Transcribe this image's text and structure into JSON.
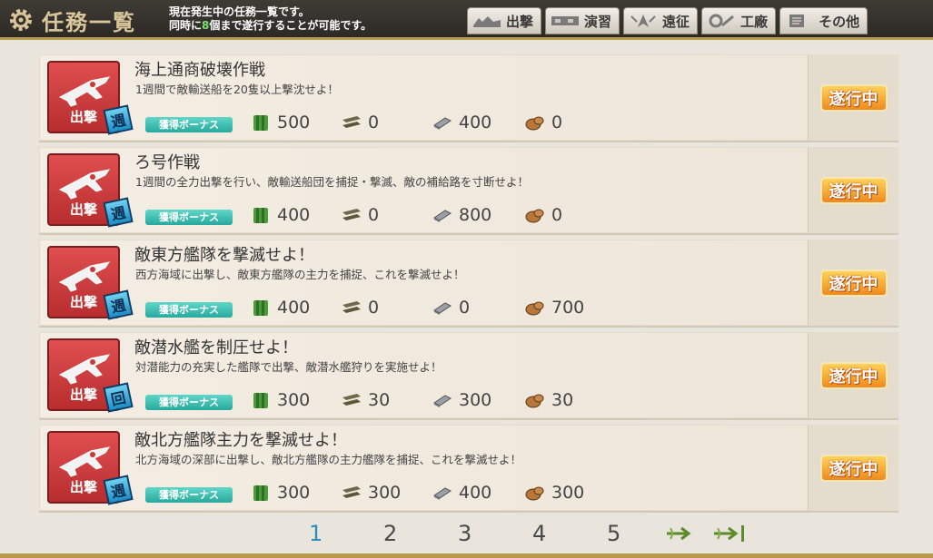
{
  "header": {
    "title": "任務一覧",
    "subtitle_line1": "現在発生中の任務一覧です。",
    "subtitle_line2_pre": "同時に",
    "subtitle_line2_num": "8",
    "subtitle_line2_post": "個まで遂行することが可能です。",
    "tabs": [
      {
        "label": "出撃",
        "icon": "sortie-icon"
      },
      {
        "label": "演習",
        "icon": "exercise-icon"
      },
      {
        "label": "遠征",
        "icon": "expedition-icon"
      },
      {
        "label": "工廠",
        "icon": "arsenal-icon"
      },
      {
        "label": "その他",
        "icon": "other-icon"
      }
    ]
  },
  "quests": [
    {
      "name": "海上通商破壊作戦",
      "desc": "1週間で敵輸送船を20隻以上撃沈せよ！",
      "category": "出撃",
      "freq": "週",
      "bonus": "獲得ボーナス",
      "fuel": "500",
      "ammo": "0",
      "steel": "400",
      "bauxite": "0",
      "status": "遂行中"
    },
    {
      "name": "ろ号作戦",
      "desc": "1週間の全力出撃を行い、敵輸送船団を捕捉・撃滅、敵の補給路を寸断せよ！",
      "category": "出撃",
      "freq": "週",
      "bonus": "獲得ボーナス",
      "fuel": "400",
      "ammo": "0",
      "steel": "800",
      "bauxite": "0",
      "status": "遂行中"
    },
    {
      "name": "敵東方艦隊を撃滅せよ！",
      "desc": "西方海域に出撃し、敵東方艦隊の主力を捕捉、これを撃滅せよ！",
      "category": "出撃",
      "freq": "週",
      "bonus": "獲得ボーナス",
      "fuel": "400",
      "ammo": "0",
      "steel": "0",
      "bauxite": "700",
      "status": "遂行中"
    },
    {
      "name": "敵潜水艦を制圧せよ！",
      "desc": "対潜能力の充実した艦隊で出撃、敵潜水艦狩りを実施せよ！",
      "category": "出撃",
      "freq": "回",
      "bonus": "獲得ボーナス",
      "fuel": "300",
      "ammo": "30",
      "steel": "300",
      "bauxite": "30",
      "status": "遂行中"
    },
    {
      "name": "敵北方艦隊主力を撃滅せよ！",
      "desc": "北方海域の深部に出撃し、敵北方艦隊の主力艦隊を捕捉、これを撃滅せよ！",
      "category": "出撃",
      "freq": "週",
      "bonus": "獲得ボーナス",
      "fuel": "300",
      "ammo": "300",
      "steel": "400",
      "bauxite": "300",
      "status": "遂行中"
    }
  ],
  "pagination": {
    "pages": [
      "1",
      "2",
      "3",
      "4",
      "5"
    ],
    "current": "1"
  },
  "colors": {
    "accent_gold": "#b89a4c",
    "category_red": "#c8393b",
    "status_orange": "#f08a1d",
    "bonus_teal": "#27a99d",
    "current_page_blue": "#2a8fb8"
  }
}
